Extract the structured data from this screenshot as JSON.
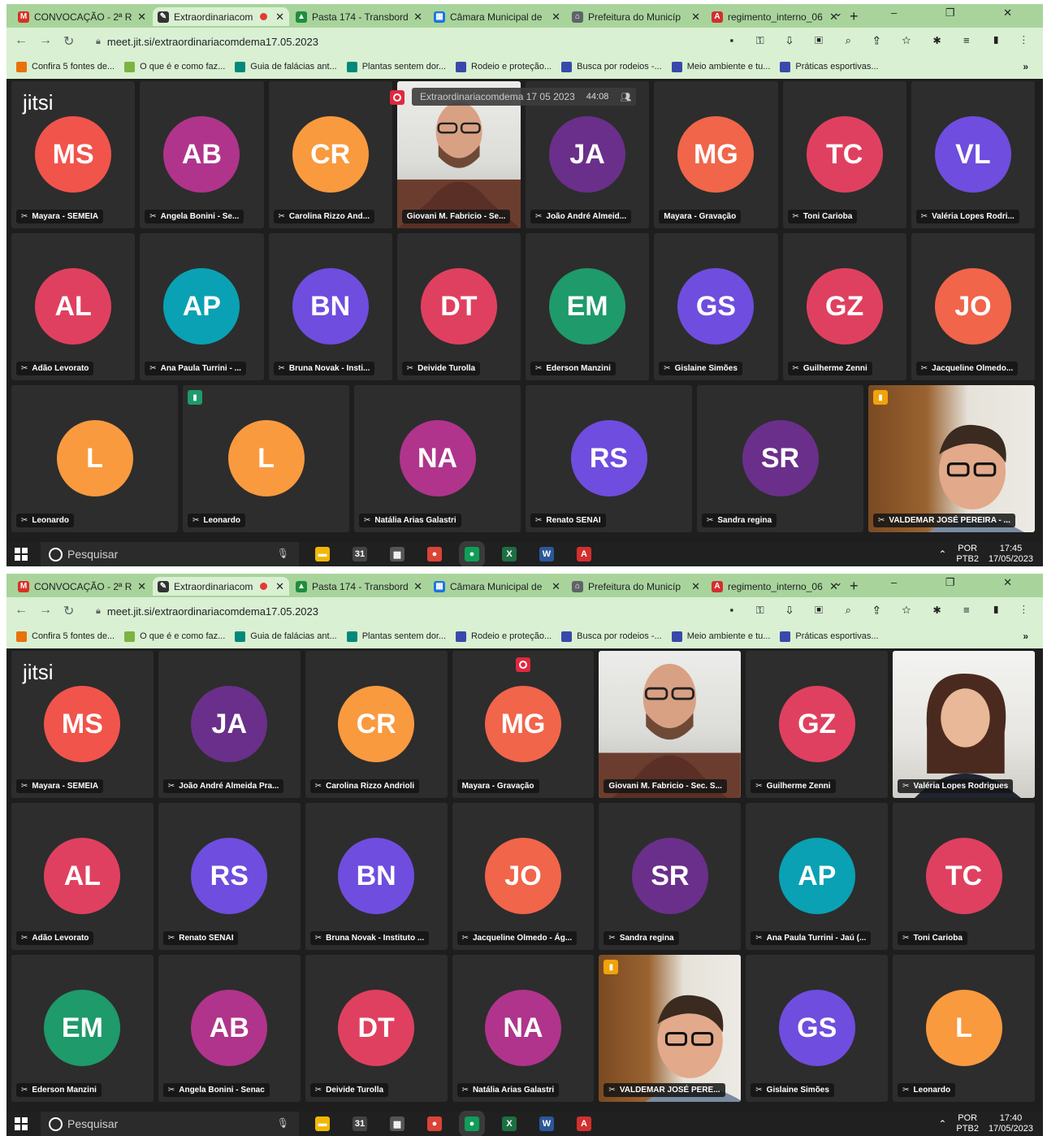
{
  "browser": {
    "tabs": [
      {
        "label": "CONVOCAÇÃO - 2ª R",
        "favicon": "gmail-icon",
        "color": "#d93025",
        "glyph": "M"
      },
      {
        "label": "Extraordinariacom",
        "favicon": "jitsi-icon",
        "color": "#333333",
        "glyph": "✎",
        "active": true,
        "recording": true
      },
      {
        "label": "Pasta 174 - Transbord",
        "favicon": "drive-icon",
        "color": "#1e8e3e",
        "glyph": "▲"
      },
      {
        "label": "Câmara Municipal de",
        "favicon": "camara-icon",
        "color": "#1a73e8",
        "glyph": "▦"
      },
      {
        "label": "Prefeitura do Municíp",
        "favicon": "prefeitura-icon",
        "color": "#5f6368",
        "glyph": "⌂"
      },
      {
        "label": "regimento_interno_06",
        "favicon": "pdf-icon",
        "color": "#d32f2f",
        "glyph": "A"
      }
    ],
    "new_tab": "+",
    "url": "meet.jit.si/extraordinariacomdema17.05.2023",
    "bookmarks": [
      {
        "label": "Confira 5 fontes de...",
        "color": "#e8710a"
      },
      {
        "label": "O que é e como faz...",
        "color": "#7cb342"
      },
      {
        "label": "Guia de falácias ant...",
        "color": "#00897b"
      },
      {
        "label": "Plantas sentem dor...",
        "color": "#00897b"
      },
      {
        "label": "Rodeio e proteção...",
        "color": "#3949ab"
      },
      {
        "label": "Busca por rodeios -...",
        "color": "#3949ab"
      },
      {
        "label": "Meio ambiente e tu...",
        "color": "#3949ab"
      },
      {
        "label": "Práticas esportivas...",
        "color": "#3949ab"
      }
    ],
    "bookmarks_more": "»"
  },
  "meeting": {
    "logo": "jitsi",
    "subject": "Extraordinariacomdema 17 05 2023",
    "timer": "44:08"
  },
  "screens": [
    {
      "rows": [
        [
          {
            "initials": "MS",
            "name": "Mayara - SEMEIA",
            "color": "#f1544b",
            "mic": true
          },
          {
            "initials": "AB",
            "name": "Angela Bonini - Se...",
            "color": "#b0348c",
            "mic": true
          },
          {
            "initials": "CR",
            "name": "Carolina Rizzo And...",
            "color": "#f99a3f",
            "mic": true
          },
          {
            "initials": "",
            "name": "Giovani M. Fabricio - Se...",
            "color": "",
            "mic": false,
            "video": "man",
            "active": true
          },
          {
            "initials": "JA",
            "name": "João André Almeid...",
            "color": "#6a2f8a",
            "mic": true
          },
          {
            "initials": "MG",
            "name": "Mayara - Gravação",
            "color": "#f1654a",
            "mic": false
          },
          {
            "initials": "TC",
            "name": "Toni Carioba",
            "color": "#e0405f",
            "mic": true
          },
          {
            "initials": "VL",
            "name": "Valéria Lopes Rodri...",
            "color": "#6f4ddf",
            "mic": true
          }
        ],
        [
          {
            "initials": "AL",
            "name": "Adão Levorato",
            "color": "#e0405f",
            "mic": true
          },
          {
            "initials": "AP",
            "name": "Ana Paula Turrini - ...",
            "color": "#0aa1b4",
            "mic": true
          },
          {
            "initials": "BN",
            "name": "Bruna Novak - Insti...",
            "color": "#6f4ddf",
            "mic": true
          },
          {
            "initials": "DT",
            "name": "Deivide Turolla",
            "color": "#e0405f",
            "mic": true
          },
          {
            "initials": "EM",
            "name": "Ederson Manzini",
            "color": "#1e9a6b",
            "mic": true
          },
          {
            "initials": "GS",
            "name": "Gislaine Simões",
            "color": "#6f4ddf",
            "mic": true
          },
          {
            "initials": "GZ",
            "name": "Guilherme Zenni",
            "color": "#e0405f",
            "mic": true
          },
          {
            "initials": "JO",
            "name": "Jacqueline Olmedo...",
            "color": "#f1654a",
            "mic": true
          }
        ],
        [
          {
            "initials": "L",
            "name": "Leonardo",
            "color": "#f99a3f",
            "mic": true
          },
          {
            "initials": "L",
            "name": "Leonardo",
            "color": "#f99a3f",
            "mic": true,
            "signal": "#1e9a6b"
          },
          {
            "initials": "NA",
            "name": "Natália Arias Galastri",
            "color": "#b0348c",
            "mic": true
          },
          {
            "initials": "RS",
            "name": "Renato SENAI",
            "color": "#6f4ddf",
            "mic": true
          },
          {
            "initials": "SR",
            "name": "Sandra regina",
            "color": "#6a2f8a",
            "mic": true
          },
          {
            "initials": "",
            "name": "VALDEMAR JOSÉ PEREIRA - ...",
            "color": "",
            "mic": true,
            "video": "valdemar1",
            "signal": "#f0a30a"
          }
        ]
      ],
      "clock_time": "17:45",
      "clock_date": "17/05/2023"
    },
    {
      "rows": [
        [
          {
            "initials": "MS",
            "name": "Mayara - SEMEIA",
            "color": "#f1544b",
            "mic": true
          },
          {
            "initials": "JA",
            "name": "João André Almeida Pra...",
            "color": "#6a2f8a",
            "mic": true
          },
          {
            "initials": "CR",
            "name": "Carolina Rizzo Andrioli",
            "color": "#f99a3f",
            "mic": true
          },
          {
            "initials": "MG",
            "name": "Mayara - Gravação",
            "color": "#f1654a",
            "mic": false,
            "rec": true
          },
          {
            "initials": "",
            "name": "Giovani M. Fabricio - Sec. S...",
            "color": "",
            "mic": false,
            "video": "man",
            "active": true
          },
          {
            "initials": "GZ",
            "name": "Guilherme Zenni",
            "color": "#e0405f",
            "mic": true
          },
          {
            "initials": "",
            "name": "Valéria Lopes Rodrigues",
            "color": "",
            "mic": true,
            "video": "woman"
          }
        ],
        [
          {
            "initials": "AL",
            "name": "Adão Levorato",
            "color": "#e0405f",
            "mic": true
          },
          {
            "initials": "RS",
            "name": "Renato SENAI",
            "color": "#6f4ddf",
            "mic": true
          },
          {
            "initials": "BN",
            "name": "Bruna Novak - Instituto ...",
            "color": "#6f4ddf",
            "mic": true
          },
          {
            "initials": "JO",
            "name": "Jacqueline Olmedo - Ág...",
            "color": "#f1654a",
            "mic": true
          },
          {
            "initials": "SR",
            "name": "Sandra regina",
            "color": "#6a2f8a",
            "mic": true
          },
          {
            "initials": "AP",
            "name": "Ana Paula Turrini - Jaú (...",
            "color": "#0aa1b4",
            "mic": true
          },
          {
            "initials": "TC",
            "name": "Toni Carioba",
            "color": "#e0405f",
            "mic": true
          }
        ],
        [
          {
            "initials": "EM",
            "name": "Ederson Manzini",
            "color": "#1e9a6b",
            "mic": true
          },
          {
            "initials": "AB",
            "name": "Angela Bonini - Senac",
            "color": "#b0348c",
            "mic": true
          },
          {
            "initials": "DT",
            "name": "Deivide Turolla",
            "color": "#e0405f",
            "mic": true
          },
          {
            "initials": "NA",
            "name": "Natália Arias Galastri",
            "color": "#b0348c",
            "mic": true
          },
          {
            "initials": "",
            "name": "VALDEMAR JOSÉ PERE...",
            "color": "",
            "mic": true,
            "video": "valdemar2",
            "signal": "#f0a30a"
          },
          {
            "initials": "GS",
            "name": "Gislaine Simões",
            "color": "#6f4ddf",
            "mic": true
          },
          {
            "initials": "L",
            "name": "Leonardo",
            "color": "#f99a3f",
            "mic": true
          }
        ]
      ],
      "clock_time": "17:40",
      "clock_date": "17/05/2023"
    }
  ],
  "taskbar": {
    "search_placeholder": "Pesquisar",
    "apps": [
      {
        "name": "file-explorer-icon",
        "color": "#f2b705",
        "glyph": "▬"
      },
      {
        "name": "calendar-icon",
        "color": "#444444",
        "glyph": "31"
      },
      {
        "name": "calculator-icon",
        "color": "#555555",
        "glyph": "▦"
      },
      {
        "name": "chrome-icon",
        "color": "#db4437",
        "glyph": "●"
      },
      {
        "name": "chrome-profile-icon",
        "color": "#0f9d58",
        "glyph": "●",
        "selected": true
      },
      {
        "name": "excel-icon",
        "color": "#1d6f42",
        "glyph": "X"
      },
      {
        "name": "word-icon",
        "color": "#2b579a",
        "glyph": "W"
      },
      {
        "name": "acrobat-icon",
        "color": "#d32f2f",
        "glyph": "A"
      }
    ],
    "lang_top": "POR",
    "lang_bottom": "PTB2"
  }
}
